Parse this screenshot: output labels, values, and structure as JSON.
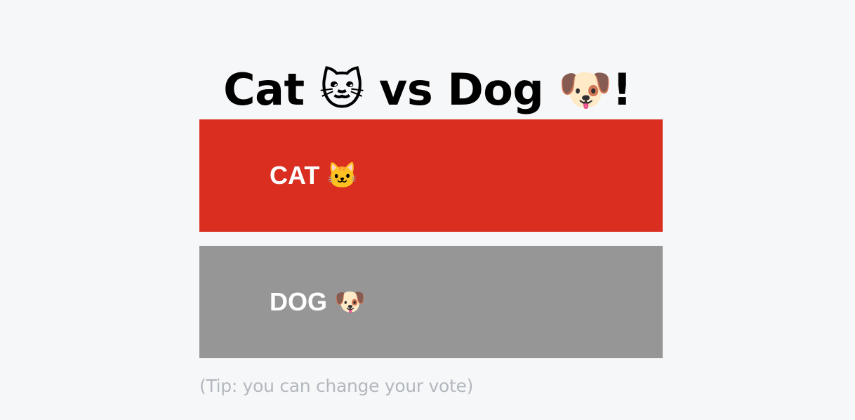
{
  "page": {
    "title": "Cat 🐱 vs Dog 🐶!"
  },
  "poll": {
    "options": [
      {
        "label": "CAT 🐱",
        "color": "#d92e20",
        "selected": true
      },
      {
        "label": "DOG 🐶",
        "color": "#969696",
        "selected": false
      }
    ]
  },
  "footer": {
    "tip": "(Tip: you can change your vote)",
    "tip_color": "#b3b8be"
  }
}
